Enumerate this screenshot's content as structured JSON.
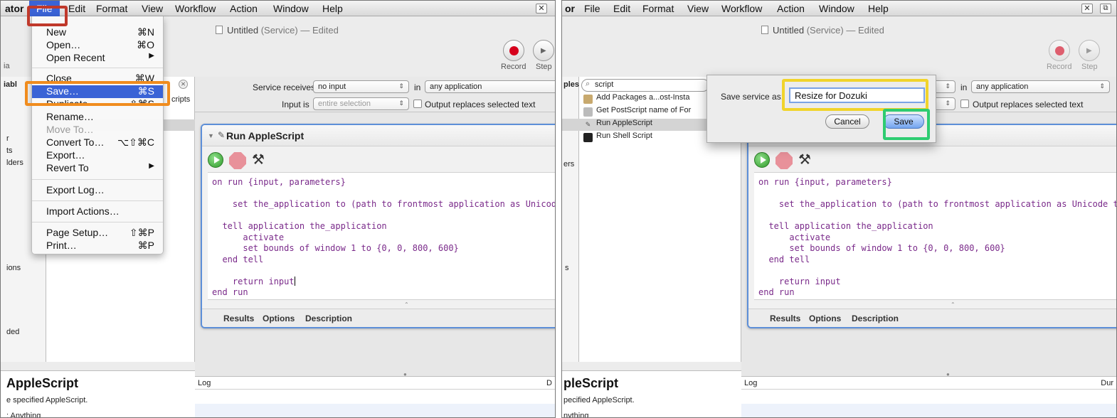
{
  "left": {
    "menubar": {
      "app_name_fragment": "ator",
      "items": [
        "File",
        "Edit",
        "Format",
        "View",
        "Workflow",
        "Action",
        "Window",
        "Help"
      ],
      "close_glyph": "✕"
    },
    "title": {
      "name": "Untitled",
      "kind": "(Service)",
      "state": "— Edited"
    },
    "toolbar": {
      "record_label": "Record",
      "step_label": "Step"
    },
    "sidebar_fragments": [
      "ia",
      "iabl",
      "r",
      "ts",
      "lders",
      "ions",
      "ded"
    ],
    "action_list_fragment": "cripts",
    "file_menu": {
      "items": [
        {
          "label": "New",
          "shortcut": "⌘N",
          "state": "normal"
        },
        {
          "label": "Open…",
          "shortcut": "⌘O",
          "state": "normal"
        },
        {
          "label": "Open Recent",
          "shortcut": "▶",
          "state": "normal"
        },
        {
          "label": "Close",
          "shortcut": "⌘W",
          "state": "normal"
        },
        {
          "label": "Save…",
          "shortcut": "⌘S",
          "state": "highlighted"
        },
        {
          "label": "Duplicate",
          "shortcut": "⇧⌘S",
          "state": "normal"
        },
        {
          "label": "Rename…",
          "shortcut": "",
          "state": "normal"
        },
        {
          "label": "Move To…",
          "shortcut": "",
          "state": "disabled"
        },
        {
          "label": "Convert To…",
          "shortcut": "⌥⇧⌘C",
          "state": "normal"
        },
        {
          "label": "Export…",
          "shortcut": "",
          "state": "normal"
        },
        {
          "label": "Revert To",
          "shortcut": "▶",
          "state": "normal"
        },
        {
          "label": "Export Log…",
          "shortcut": "",
          "state": "normal"
        },
        {
          "label": "Import Actions…",
          "shortcut": "",
          "state": "normal"
        },
        {
          "label": "Page Setup…",
          "shortcut": "⇧⌘P",
          "state": "normal"
        },
        {
          "label": "Print…",
          "shortcut": "⌘P",
          "state": "normal"
        }
      ]
    },
    "description": {
      "title": "AppleScript",
      "line1": "e specified AppleScript.",
      "line2": ": Anything"
    }
  },
  "right": {
    "menubar": {
      "app_name_fragment": "or",
      "items": [
        "File",
        "Edit",
        "Format",
        "View",
        "Workflow",
        "Action",
        "Window",
        "Help"
      ],
      "close_glyph": "✕"
    },
    "title": {
      "name": "Untitled",
      "kind": "(Service)",
      "state": "— Edited"
    },
    "toolbar": {
      "record_label": "Record",
      "step_label": "Step"
    },
    "sidebar_fragments": [
      "ples",
      "ers",
      "s"
    ],
    "search": {
      "value": "script"
    },
    "results": [
      {
        "label": "Add Packages a...ost-Insta",
        "icon": "package-icon"
      },
      {
        "label": "Get PostScript name of For",
        "icon": "font-icon"
      },
      {
        "label": "Run AppleScript",
        "icon": "applescript-icon"
      },
      {
        "label": "Run Shell Script",
        "icon": "terminal-icon"
      }
    ],
    "save_sheet": {
      "label": "Save service as:",
      "value": "Resize for Dozuki",
      "cancel": "Cancel",
      "save": "Save"
    },
    "description": {
      "title": "pleScript",
      "line1": "pecified AppleScript.",
      "line2": "nything"
    },
    "log_header_right": "Dur"
  },
  "workflow": {
    "service_receives_label": "Service receives",
    "service_receives_value": "no input",
    "in_label": "in",
    "in_value": "any application",
    "input_is_label": "Input is",
    "input_is_value": "entire selection",
    "output_replaces": "Output replaces selected text",
    "action_title": "Run AppleScript",
    "code_lines": [
      "on run {input, parameters}",
      "",
      "    set the_application to (path to frontmost application as Unicode text)",
      "",
      "  tell application the_application",
      "      activate",
      "      set bounds of window 1 to {0, 0, 800, 600}",
      "  end tell",
      "",
      "    return input",
      "end run"
    ],
    "tabs": [
      "Results",
      "Options",
      "Description"
    ],
    "log_label": "Log",
    "log_header_right_left": "D"
  },
  "colors": {
    "menu_highlight": "#3a63d6",
    "file_box": "#c0392b",
    "save_box": "#f08c1e",
    "field_box": "#f1d42c",
    "button_box": "#2ecc71"
  }
}
